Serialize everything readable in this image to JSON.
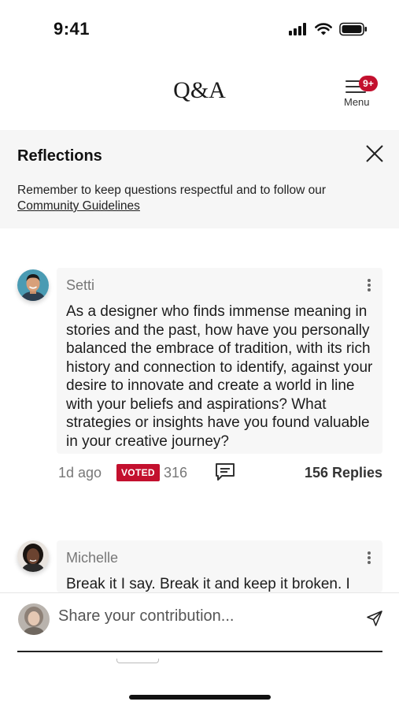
{
  "status_bar": {
    "time": "9:41",
    "icons": [
      "signal-icon",
      "wifi-icon",
      "battery-icon"
    ]
  },
  "header": {
    "title": "Q&A",
    "menu_label": "Menu",
    "menu_badge": "9+"
  },
  "banner": {
    "title": "Reflections",
    "text": "Remember to keep questions respectful and to follow our",
    "link": "Community Guidelines"
  },
  "posts": [
    {
      "author": "Setti",
      "body": "As a designer who finds immense meaning in stories and the past, how have you personally balanced the embrace of tradition, with its rich history and connection to identify, against your desire to innovate and create a world in line with your beliefs and aspirations? What strategies or insights have you found valuable in your creative journey?",
      "time": "1d ago",
      "voted_label": "VOTED",
      "votes": "316",
      "replies": "156 Replies"
    },
    {
      "author": "Michelle",
      "body": "Break it I say. Break it and keep it broken. I"
    }
  ],
  "composer": {
    "placeholder": "Share your contribution..."
  },
  "colors": {
    "accent": "#c3102e",
    "banner_bg": "#f6f6f6",
    "card_bg": "#f7f7f7"
  }
}
